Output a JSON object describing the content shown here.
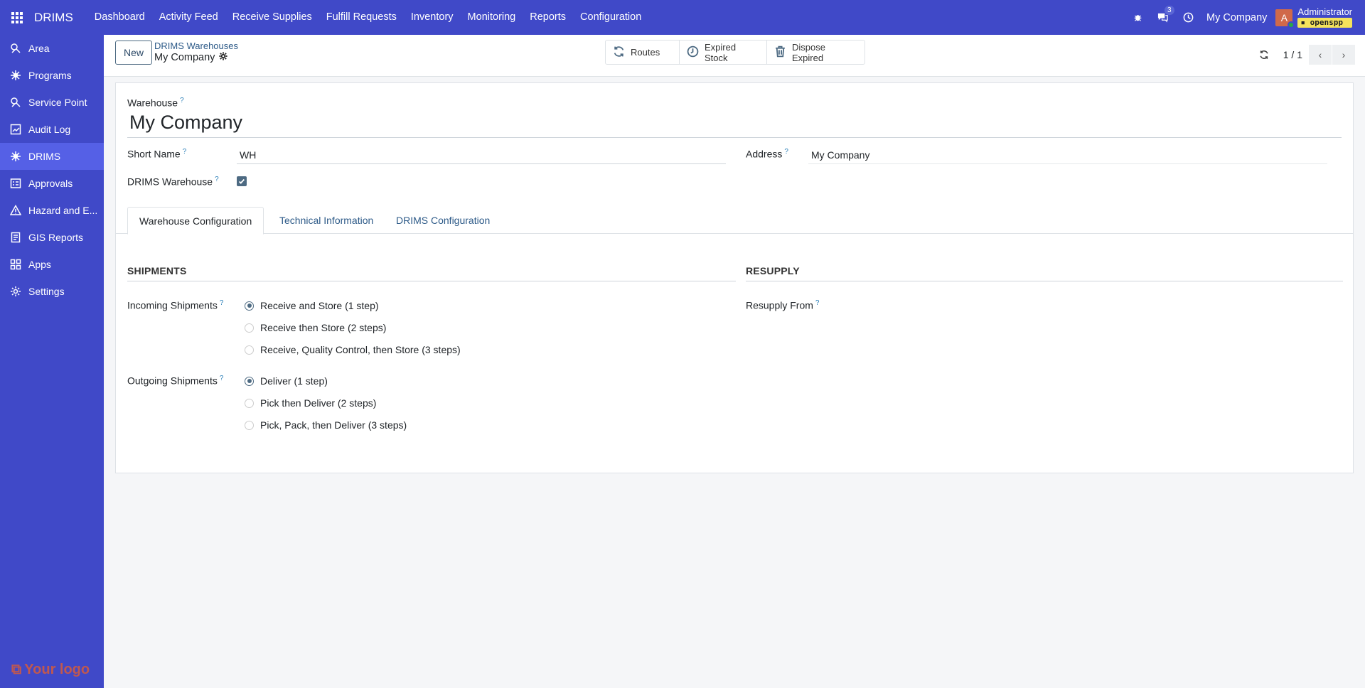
{
  "topbar": {
    "brand": "DRIMS",
    "menu": [
      "Dashboard",
      "Activity Feed",
      "Receive Supplies",
      "Fulfill Requests",
      "Inventory",
      "Monitoring",
      "Reports",
      "Configuration"
    ],
    "messages_count": "3",
    "company": "My Company",
    "avatar_letter": "A",
    "user_name": "Administrator",
    "database": "openspp"
  },
  "sidebar": {
    "items": [
      {
        "label": "Area",
        "icon": "area-icon"
      },
      {
        "label": "Programs",
        "icon": "programs-icon"
      },
      {
        "label": "Service Point",
        "icon": "service-point-icon"
      },
      {
        "label": "Audit Log",
        "icon": "audit-log-icon"
      },
      {
        "label": "DRIMS",
        "icon": "drims-icon",
        "active": true
      },
      {
        "label": "Approvals",
        "icon": "approvals-icon"
      },
      {
        "label": "Hazard and E...",
        "icon": "hazard-icon"
      },
      {
        "label": "GIS Reports",
        "icon": "gis-reports-icon"
      },
      {
        "label": "Apps",
        "icon": "apps-icon"
      },
      {
        "label": "Settings",
        "icon": "settings-icon"
      }
    ],
    "logo_text": "Your logo"
  },
  "control": {
    "new_label": "New",
    "breadcrumb_parent": "DRIMS Warehouses",
    "breadcrumb_current": "My Company",
    "smart_buttons": [
      "Routes",
      "Expired Stock",
      "Dispose Expired"
    ],
    "pager": "1 / 1"
  },
  "form": {
    "warehouse_label": "Warehouse",
    "warehouse_name": "My Company",
    "short_name_label": "Short Name",
    "short_name_value": "WH",
    "address_label": "Address",
    "address_value": "My Company",
    "drims_warehouse_label": "DRIMS Warehouse",
    "drims_warehouse_checked": true,
    "help_mark": "?",
    "tabs": [
      "Warehouse Configuration",
      "Technical Information",
      "DRIMS Configuration"
    ],
    "shipments_title": "SHIPMENTS",
    "resupply_title": "RESUPPLY",
    "incoming_label": "Incoming Shipments",
    "incoming_options": [
      "Receive and Store (1 step)",
      "Receive then Store (2 steps)",
      "Receive, Quality Control, then Store (3 steps)"
    ],
    "outgoing_label": "Outgoing Shipments",
    "outgoing_options": [
      "Deliver (1 step)",
      "Pick then Deliver (2 steps)",
      "Pick, Pack, then Deliver (3 steps)"
    ],
    "resupply_from_label": "Resupply From"
  },
  "colors": {
    "navbar": "#4049c8",
    "sidebar_active": "#5560e6",
    "accent": "#4d6a82",
    "link": "#2d5a88"
  }
}
